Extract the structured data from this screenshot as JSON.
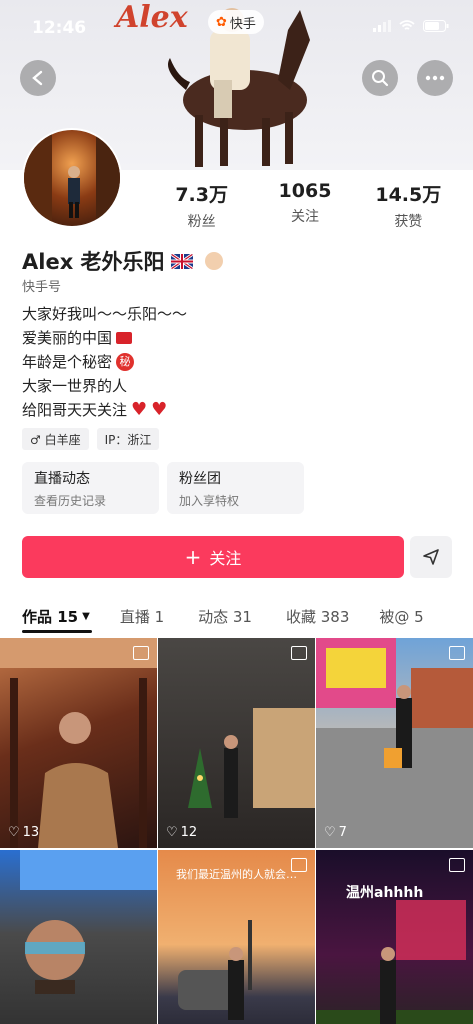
{
  "status_bar": {
    "time": "12:46"
  },
  "banner": {
    "title": "Alex",
    "app_badge": "快手"
  },
  "stats": [
    {
      "value": "7.3万",
      "label": "粉丝"
    },
    {
      "value": "1065",
      "label": "关注"
    },
    {
      "value": "14.5万",
      "label": "获赞"
    }
  ],
  "profile": {
    "name": "Alex 老外乐阳",
    "kuaishou_id_label": "快手号",
    "bio": [
      "大家好我叫～～乐阳～～",
      "爱美丽的中国",
      "年龄是个秘密",
      "大家一世界的人",
      "给阳哥天天关注"
    ],
    "secret_badge": "秘",
    "tags": [
      "♂ 白羊座",
      "IP：浙江"
    ]
  },
  "cards": [
    {
      "title": "直播动态",
      "subtitle": "查看历史记录"
    },
    {
      "title": "粉丝团",
      "subtitle": "加入享特权"
    }
  ],
  "actions": {
    "follow_label": "关注",
    "follow_icon": "+"
  },
  "tabs": [
    {
      "label": "作品 15",
      "active": true
    },
    {
      "label": "直播 1"
    },
    {
      "label": "动态 31"
    },
    {
      "label": "收藏 383"
    },
    {
      "label": "被@ 5"
    }
  ],
  "grid": [
    {
      "likes": "13"
    },
    {
      "likes": "12"
    },
    {
      "likes": "7"
    },
    {
      "likes": ""
    },
    {
      "caption": "我们最近温州的人就会…",
      "likes": ""
    },
    {
      "caption": "温州ahhhh",
      "likes": ""
    }
  ],
  "colors": {
    "accent": "#fb3a5d",
    "heart": "#d8232a"
  }
}
